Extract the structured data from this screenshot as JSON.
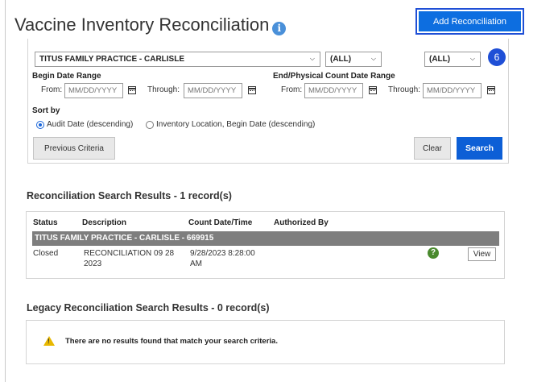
{
  "page": {
    "title": "Vaccine Inventory Reconciliation",
    "info_icon": "i",
    "add_button": "Add Reconciliation",
    "step_badge": "6"
  },
  "filters": {
    "location_select": "TITUS FAMILY PRACTICE - CARLISLE",
    "status_select_1": "(ALL)",
    "status_select_2": "(ALL)",
    "begin_date_range_label": "Begin Date Range",
    "end_date_range_label": "End/Physical Count Date Range",
    "from_label": "From:",
    "through_label": "Through:",
    "date_placeholder": "MM/DD/YYYY",
    "sort_by_label": "Sort by",
    "sort_options": [
      {
        "label": "Audit Date (descending)",
        "selected": true
      },
      {
        "label": "Inventory Location, Begin Date (descending)",
        "selected": false
      }
    ],
    "previous_criteria_button": "Previous Criteria",
    "clear_button": "Clear",
    "search_button": "Search"
  },
  "results": {
    "title": "Reconciliation Search Results - 1 record(s)",
    "columns": [
      "Status",
      "Description",
      "Count Date/Time",
      "Authorized By"
    ],
    "group_label": "TITUS FAMILY PRACTICE - CARLISLE - 669915",
    "rows": [
      {
        "status": "Closed",
        "description_line1": "RECONCILIATION 09 28",
        "description_line2": "2023",
        "count_line1": "9/28/2023 8:28:00",
        "count_line2": "AM",
        "authorized_by": "",
        "help_icon": "?",
        "view_button": "View"
      }
    ]
  },
  "legacy": {
    "title": "Legacy Reconciliation Search Results - 0 record(s)",
    "warning_icon": "!",
    "empty_message": "There are no results found that match your search criteria."
  },
  "colors": {
    "primary_blue": "#0d6ee0",
    "highlight_border": "#1f4fd6",
    "group_row_grey": "#7e7e7e",
    "success_green": "#4a8a2e",
    "warning_yellow": "#e8b800"
  }
}
